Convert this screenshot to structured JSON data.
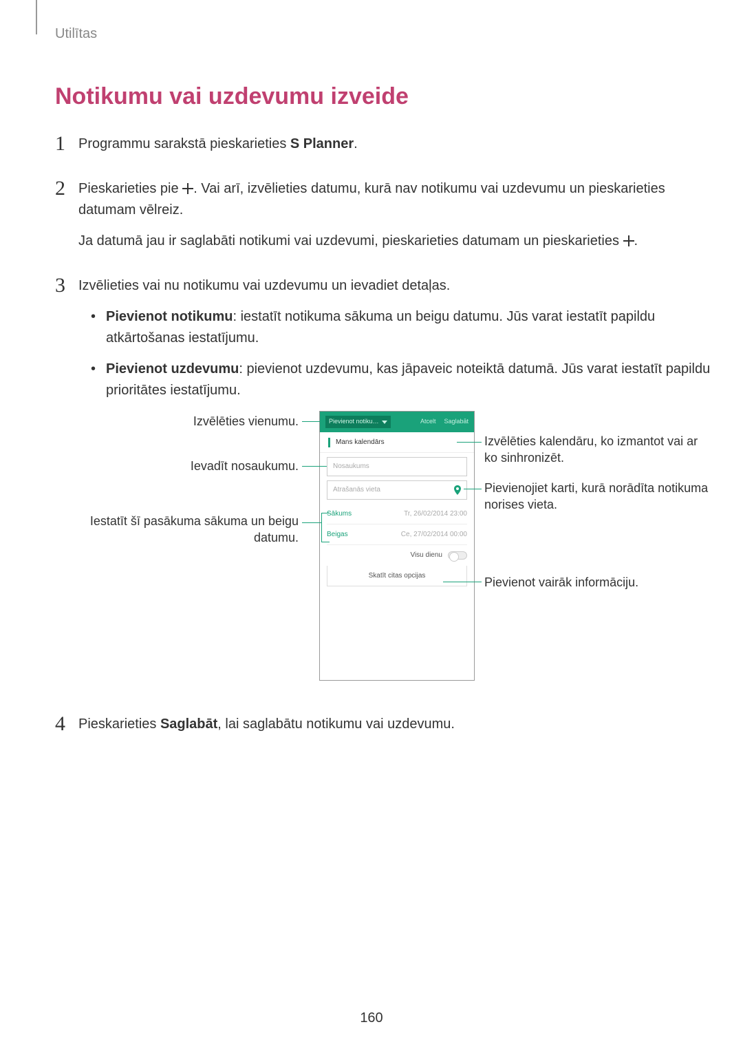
{
  "breadcrumb": "Utilītas",
  "title": "Notikumu vai uzdevumu izveide",
  "steps": {
    "s1": {
      "num": "1",
      "text_a": "Programmu sarakstā pieskarieties ",
      "bold": "S Planner",
      "text_b": "."
    },
    "s2": {
      "num": "2",
      "p1a": "Pieskarieties pie ",
      "p1b": ". Vai arī, izvēlieties datumu, kurā nav notikumu vai uzdevumu un pieskarieties datumam vēlreiz.",
      "p2a": "Ja datumā jau ir saglabāti notikumi vai uzdevumi, pieskarieties datumam un pieskarieties ",
      "p2b": "."
    },
    "s3": {
      "num": "3",
      "intro": "Izvēlieties vai nu notikumu vai uzdevumu un ievadiet detaļas.",
      "b1_bold": "Pievienot notikumu",
      "b1_text": ": iestatīt notikuma sākuma un beigu datumu. Jūs varat iestatīt papildu atkārtošanas iestatījumu.",
      "b2_bold": "Pievienot uzdevumu",
      "b2_text": ": pievienot uzdevumu, kas jāpaveic noteiktā datumā. Jūs varat iestatīt papildu prioritātes iestatījumu."
    },
    "s4": {
      "num": "4",
      "text_a": "Pieskarieties ",
      "bold": "Saglabāt",
      "text_b": ", lai saglabātu notikumu vai uzdevumu."
    }
  },
  "callouts": {
    "left1": "Izvēlēties vienumu.",
    "left2": "Ievadīt nosaukumu.",
    "left3": "Iestatīt šī pasākuma sākuma un beigu datumu.",
    "right1": "Izvēlēties kalendāru, ko izmantot vai ar ko sinhronizēt.",
    "right2": "Pievienojiet karti, kurā norādīta notikuma norises vieta.",
    "right3": "Pievienot vairāk informāciju."
  },
  "phone": {
    "tab": "Pievienot notiku…",
    "cancel": "Atcelt",
    "save": "Saglabāt",
    "calendar": "Mans kalendārs",
    "name_ph": "Nosaukums",
    "loc_ph": "Atrašanās vieta",
    "start_label": "Sākums",
    "start_val": "Tr, 26/02/2014   23:00",
    "end_label": "Beigas",
    "end_val": "Ce, 27/02/2014   00:00",
    "allday": "Visu dienu",
    "more": "Skatīt citas opcijas"
  },
  "page_num": "160"
}
